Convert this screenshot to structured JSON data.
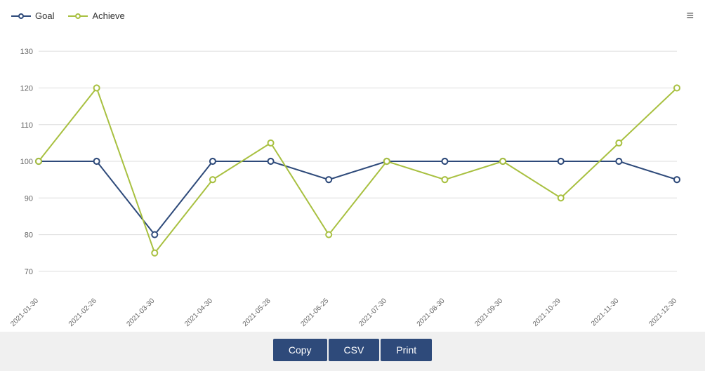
{
  "legend": {
    "goal_label": "Goal",
    "achieve_label": "Achieve"
  },
  "menu_icon": "≡",
  "buttons": {
    "copy": "Copy",
    "csv": "CSV",
    "print": "Print"
  },
  "chart": {
    "y_labels": [
      "70",
      "80",
      "90",
      "100",
      "110",
      "120",
      "130"
    ],
    "x_labels": [
      "2021-01-30",
      "2021-02-26",
      "2021-03-30",
      "2021-04-30",
      "2021-05-28",
      "2021-06-25",
      "2021-07-30",
      "2021-08-30",
      "2021-09-30",
      "2021-10-29",
      "2021-11-30",
      "2021-12-30"
    ],
    "goal_values": [
      100,
      100,
      80,
      100,
      100,
      95,
      100,
      100,
      100,
      100,
      100,
      95
    ],
    "achieve_values": [
      100,
      120,
      75,
      95,
      105,
      80,
      100,
      95,
      100,
      90,
      105,
      120
    ]
  }
}
